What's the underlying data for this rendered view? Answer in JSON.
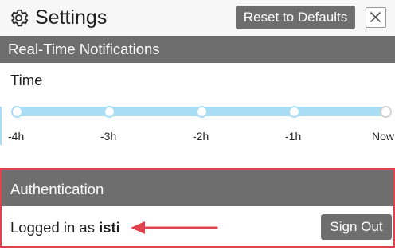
{
  "header": {
    "title": "Settings",
    "icon": "gear-icon",
    "reset_label": "Reset to Defaults",
    "close_icon": "close-icon"
  },
  "realtime": {
    "section_title": "Real-Time Notifications",
    "time_label": "Time",
    "timeline_ticks": [
      "-4h",
      "-3h",
      "-2h",
      "-1h",
      "Now"
    ]
  },
  "auth": {
    "section_title": "Authentication",
    "logged_in_prefix": "Logged in as",
    "username": "isti",
    "sign_out_label": "Sign Out"
  },
  "colors": {
    "header_bar": "#6e6e6e",
    "track": "#a8ddf5",
    "highlight_border": "#e0434e",
    "arrow": "#e0434e"
  }
}
